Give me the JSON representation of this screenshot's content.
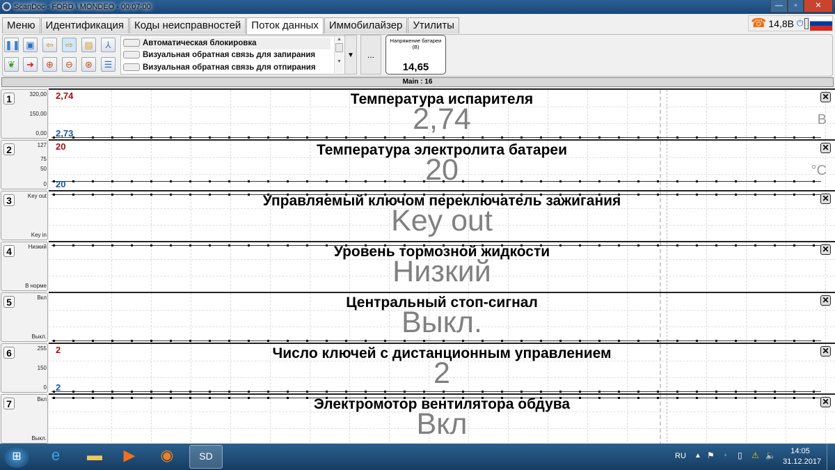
{
  "window": {
    "title": "ScanDoc - FORD \\ MONDEO - 00:07:00"
  },
  "tabs": [
    "Меню",
    "Идентификация",
    "Коды неисправностей",
    "Поток данных",
    "Иммобилайзер",
    "Утилиты"
  ],
  "active_tab": 3,
  "status": {
    "voltage": "14,8В"
  },
  "list": {
    "items": [
      "Автоматическая блокировка",
      "Визуальная обратная связь для запирания",
      "Визуальная обратная связь для отпирания"
    ],
    "more": "..."
  },
  "battery_widget": {
    "label": "Напряжение батареи (В)",
    "value": "14,65"
  },
  "mainbar": "Main : 16",
  "panels": [
    {
      "num": "1",
      "title": "Температура испарителя",
      "value": "2,74",
      "unit": "В",
      "axis": [
        "320,00",
        "150,00",
        "0,00"
      ],
      "max": "2,74",
      "min": "2,73",
      "line": "bottom"
    },
    {
      "num": "2",
      "title": "Температура электролита батареи",
      "value": "20",
      "unit": "°C",
      "axis": [
        "127",
        "75",
        "50",
        "0"
      ],
      "max": "20",
      "min": "20",
      "line": "low"
    },
    {
      "num": "3",
      "title": "Управляемый ключом переключатель зажигания",
      "value": "Key out",
      "unit": "",
      "axis": [
        "Key out",
        "Key in"
      ],
      "line": "top"
    },
    {
      "num": "4",
      "title": "Уровень тормозной жидкости",
      "value": "Низкий",
      "unit": "",
      "axis": [
        "Низкий",
        "В норме"
      ],
      "line": "top"
    },
    {
      "num": "5",
      "title": "Центральный стоп-сигнал",
      "value": "Выкл.",
      "unit": "",
      "axis": [
        "Вкл",
        "Выкл."
      ],
      "line": "bottom"
    },
    {
      "num": "6",
      "title": "Число ключей с дистанционным управлением",
      "value": "2",
      "unit": "",
      "axis": [
        "255",
        "150",
        "0"
      ],
      "max": "2",
      "min": "2",
      "line": "bottom"
    },
    {
      "num": "7",
      "title": "Электромотор вентилятора обдува",
      "value": "Вкл",
      "unit": "",
      "axis": [
        "Вкл",
        "Выкл."
      ],
      "line": "top"
    }
  ],
  "taskbar": {
    "lang": "RU",
    "time": "14:05",
    "date": "31.12.2017"
  }
}
